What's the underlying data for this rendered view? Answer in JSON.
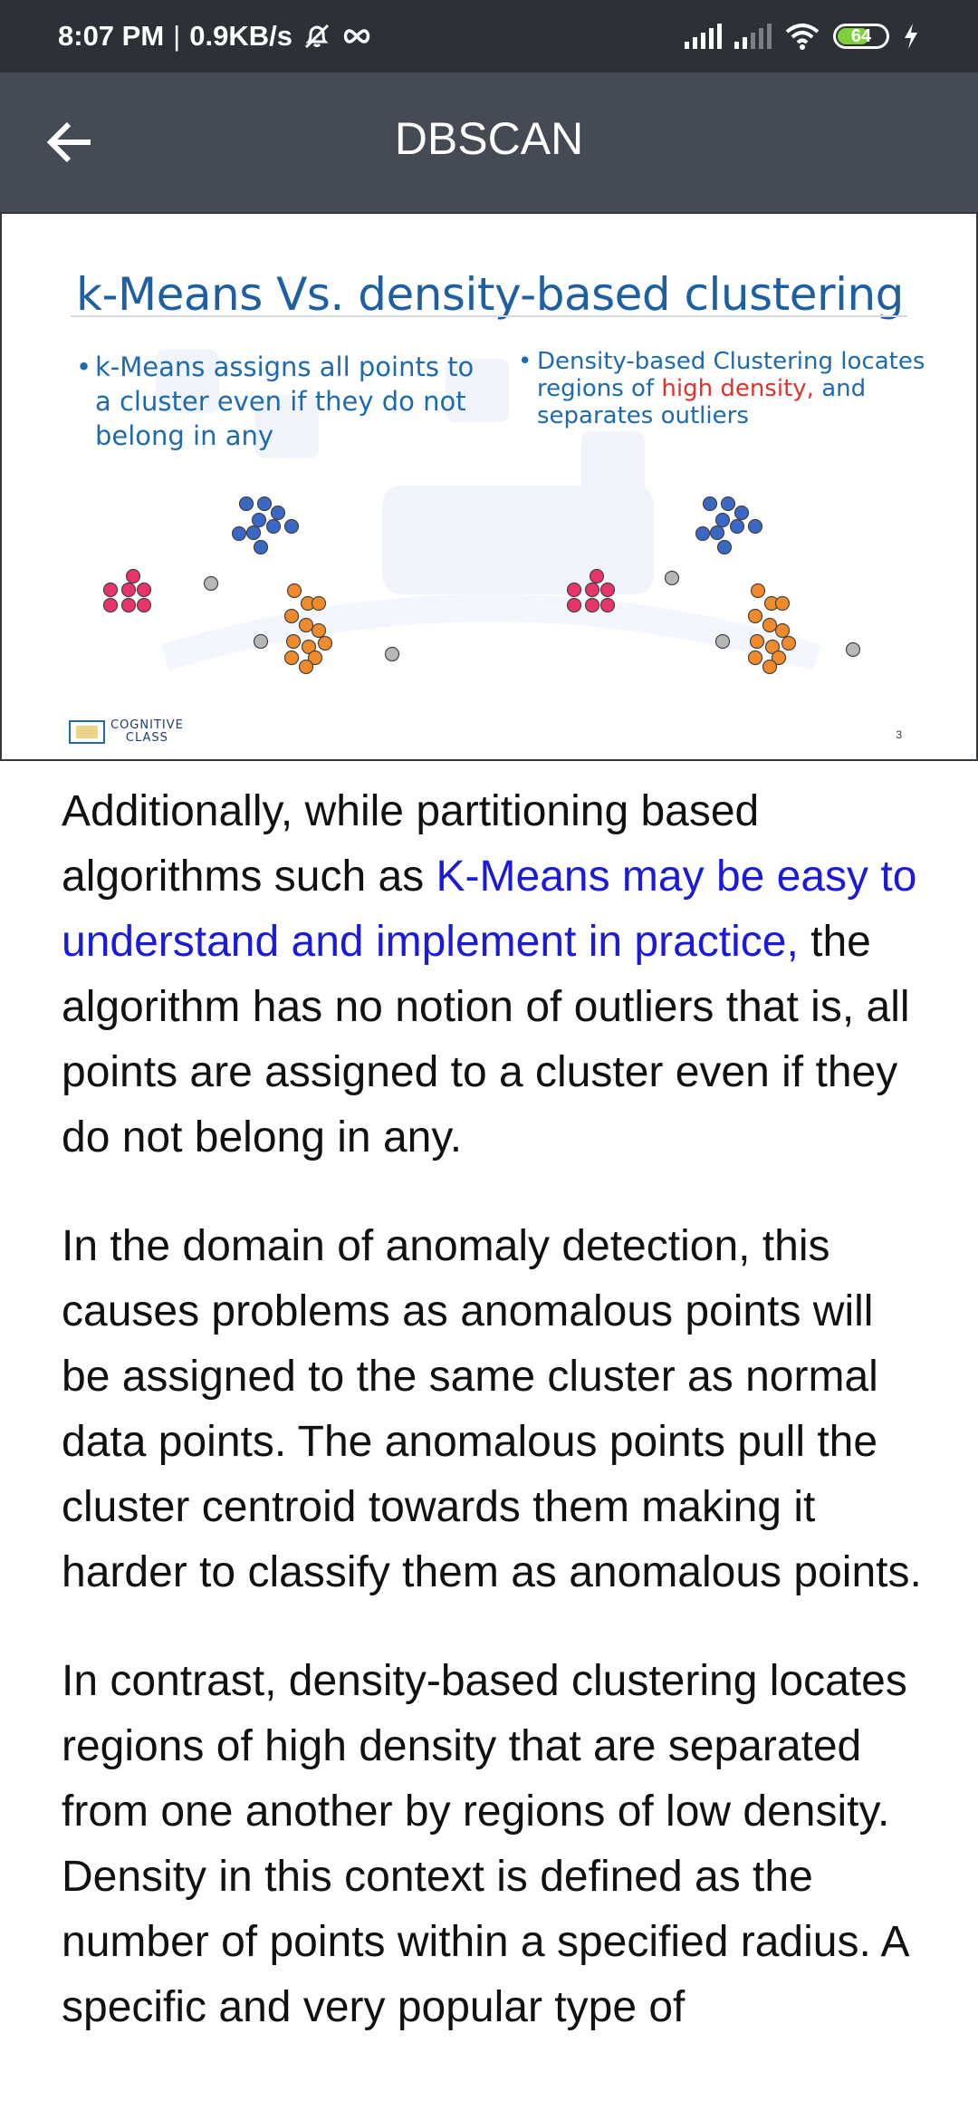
{
  "status_bar": {
    "time": "8:07 PM",
    "separator": "|",
    "speed": "0.9KB/s",
    "icons": [
      "mute-icon",
      "infinity-icon",
      "signal-icon",
      "signal-icon",
      "wifi-icon",
      "battery-icon",
      "charging-icon"
    ],
    "battery": "64"
  },
  "app_bar": {
    "title": "DBSCAN",
    "back_icon": "arrow-left-icon"
  },
  "slide": {
    "title": "k-Means Vs. density-based clustering",
    "left_bullet": "k-Means assigns all points to a cluster even if they do not belong in any",
    "right_bullet_prefix": "Density-based Clustering locates regions of",
    "right_bullet_highlight": "high density,",
    "right_bullet_suffix": "and separates outliers",
    "logo_line1": "COGNITIVE",
    "logo_line2": "CLASS",
    "page_number": "3",
    "colors": {
      "pink": "#e8336b",
      "blue": "#3a68c4",
      "orange": "#f08a2b",
      "gray": "#b7b7b7",
      "highlight": "#e0322a"
    }
  },
  "article": {
    "p1_before": "Additionally, while partitioning based algorithms such as ",
    "p1_link": "K-Means may be easy to understand and implement in practice,",
    "p1_after": " the algorithm has no notion of outliers that is, all points are assigned to a cluster even if they do not belong in any.",
    "p2": "In the domain of anomaly detection, this causes problems as anomalous points will be assigned to the same cluster as normal data points. The anomalous points pull the cluster centroid towards them making it harder to classify them as anomalous points.",
    "p3": "In contrast, density-based clustering locates regions of high density that are separated from one another by regions of low density. Density in this context is defined as the number of points within a specified radius. A specific and very popular type of"
  }
}
